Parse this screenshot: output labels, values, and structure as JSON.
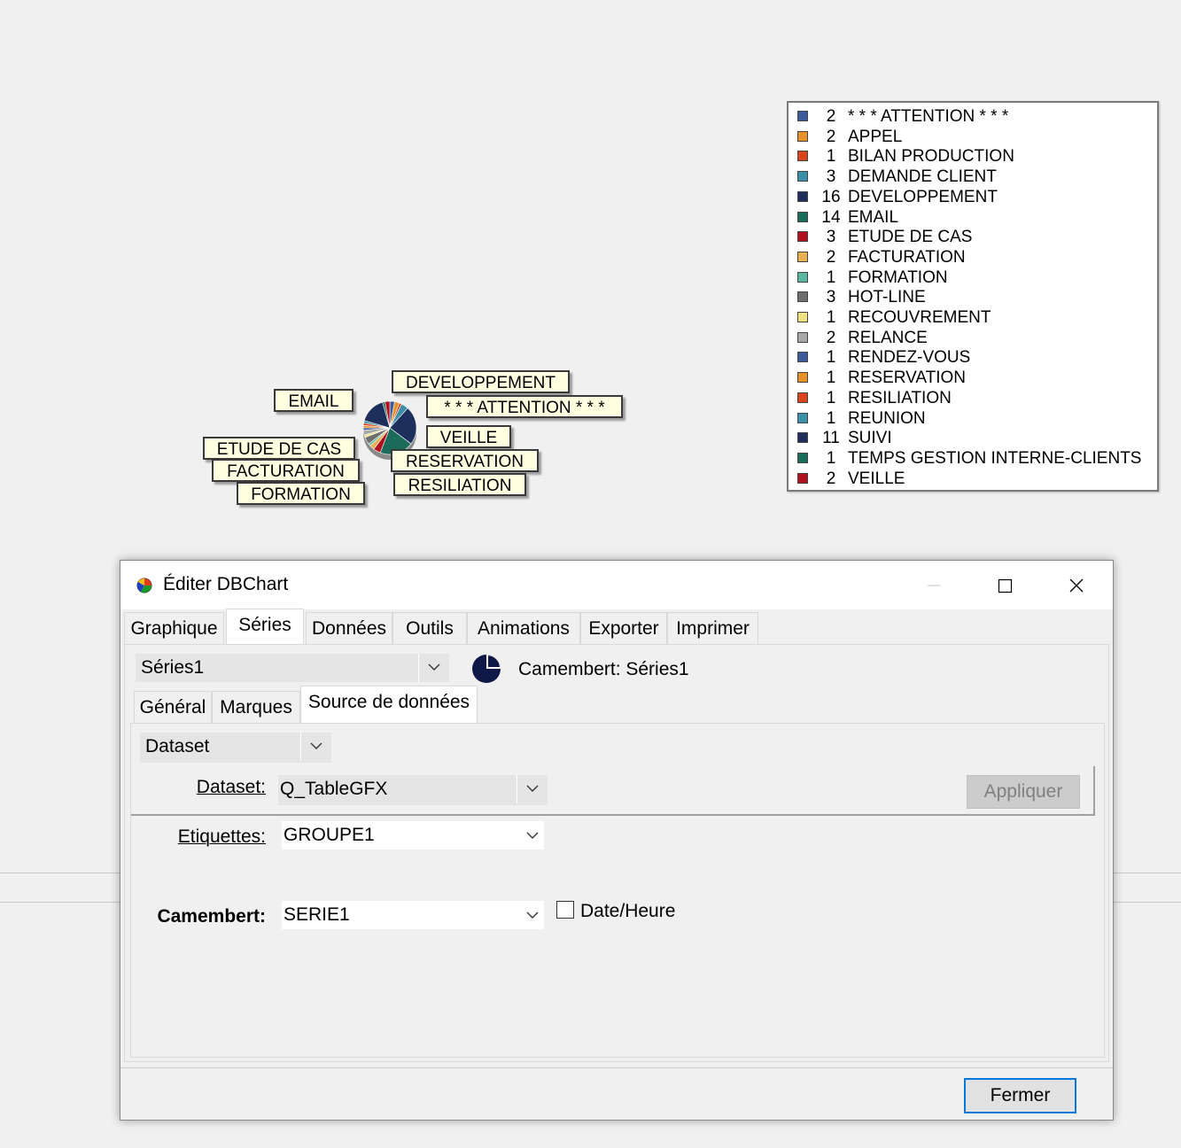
{
  "chart": {
    "legend": [
      {
        "count": "2",
        "label": "* * * ATTENTION * * *",
        "color": "#3d5a9a"
      },
      {
        "count": "2",
        "label": "APPEL",
        "color": "#e8902a"
      },
      {
        "count": "1",
        "label": "BILAN PRODUCTION",
        "color": "#d9441e"
      },
      {
        "count": "3",
        "label": "DEMANDE CLIENT",
        "color": "#3c8fa8"
      },
      {
        "count": "16",
        "label": "DEVELOPPEMENT",
        "color": "#1f2f5c"
      },
      {
        "count": "14",
        "label": "EMAIL",
        "color": "#1a6b5a"
      },
      {
        "count": "3",
        "label": "ETUDE DE CAS",
        "color": "#b01020"
      },
      {
        "count": "2",
        "label": "FACTURATION",
        "color": "#e8b050"
      },
      {
        "count": "1",
        "label": "FORMATION",
        "color": "#5ab8a0"
      },
      {
        "count": "3",
        "label": "HOT-LINE",
        "color": "#6e6e6e"
      },
      {
        "count": "1",
        "label": "RECOUVREMENT",
        "color": "#f0e080"
      },
      {
        "count": "2",
        "label": "RELANCE",
        "color": "#a8a8a8"
      },
      {
        "count": "1",
        "label": "RENDEZ-VOUS",
        "color": "#3d5a9a"
      },
      {
        "count": "1",
        "label": "RESERVATION",
        "color": "#e8902a"
      },
      {
        "count": "1",
        "label": "RESILIATION",
        "color": "#d9441e"
      },
      {
        "count": "1",
        "label": "REUNION",
        "color": "#3c8fa8"
      },
      {
        "count": "11",
        "label": "SUIVI",
        "color": "#1f2f5c"
      },
      {
        "count": "1",
        "label": "TEMPS GESTION INTERNE-CLIENTS",
        "color": "#1a6b5a"
      },
      {
        "count": "2",
        "label": "VEILLE",
        "color": "#b01020"
      }
    ],
    "pie_labels": {
      "email": "EMAIL",
      "developpement": "DEVELOPPEMENT",
      "attention": "* * * ATTENTION * * *",
      "veille": "VEILLE",
      "etude_de_cas": "ETUDE DE CAS",
      "facturation": "FACTURATION",
      "formation": "FORMATION",
      "reservation": "RESERVATION",
      "resiliation": "RESILIATION"
    }
  },
  "dialog": {
    "title": "Éditer DBChart",
    "tabs": [
      "Graphique",
      "Séries",
      "Données",
      "Outils",
      "Animations",
      "Exporter",
      "Imprimer"
    ],
    "active_tab": "Séries",
    "series_select": "Séries1",
    "series_caption": "Camembert: Séries1",
    "subtabs": [
      "Général",
      "Marques",
      "Source de données"
    ],
    "active_subtab": "Source de données",
    "source_select": "Dataset",
    "dataset_label": "Dataset:",
    "dataset_value": "Q_TableGFX",
    "apply_button": "Appliquer",
    "etiquettes_label": "Etiquettes:",
    "etiquettes_value": "GROUPE1",
    "camembert_label": "Camembert:",
    "camembert_value": "SERIE1",
    "datetime_label": "Date/Heure",
    "datetime_checked": false,
    "close_button": "Fermer"
  }
}
